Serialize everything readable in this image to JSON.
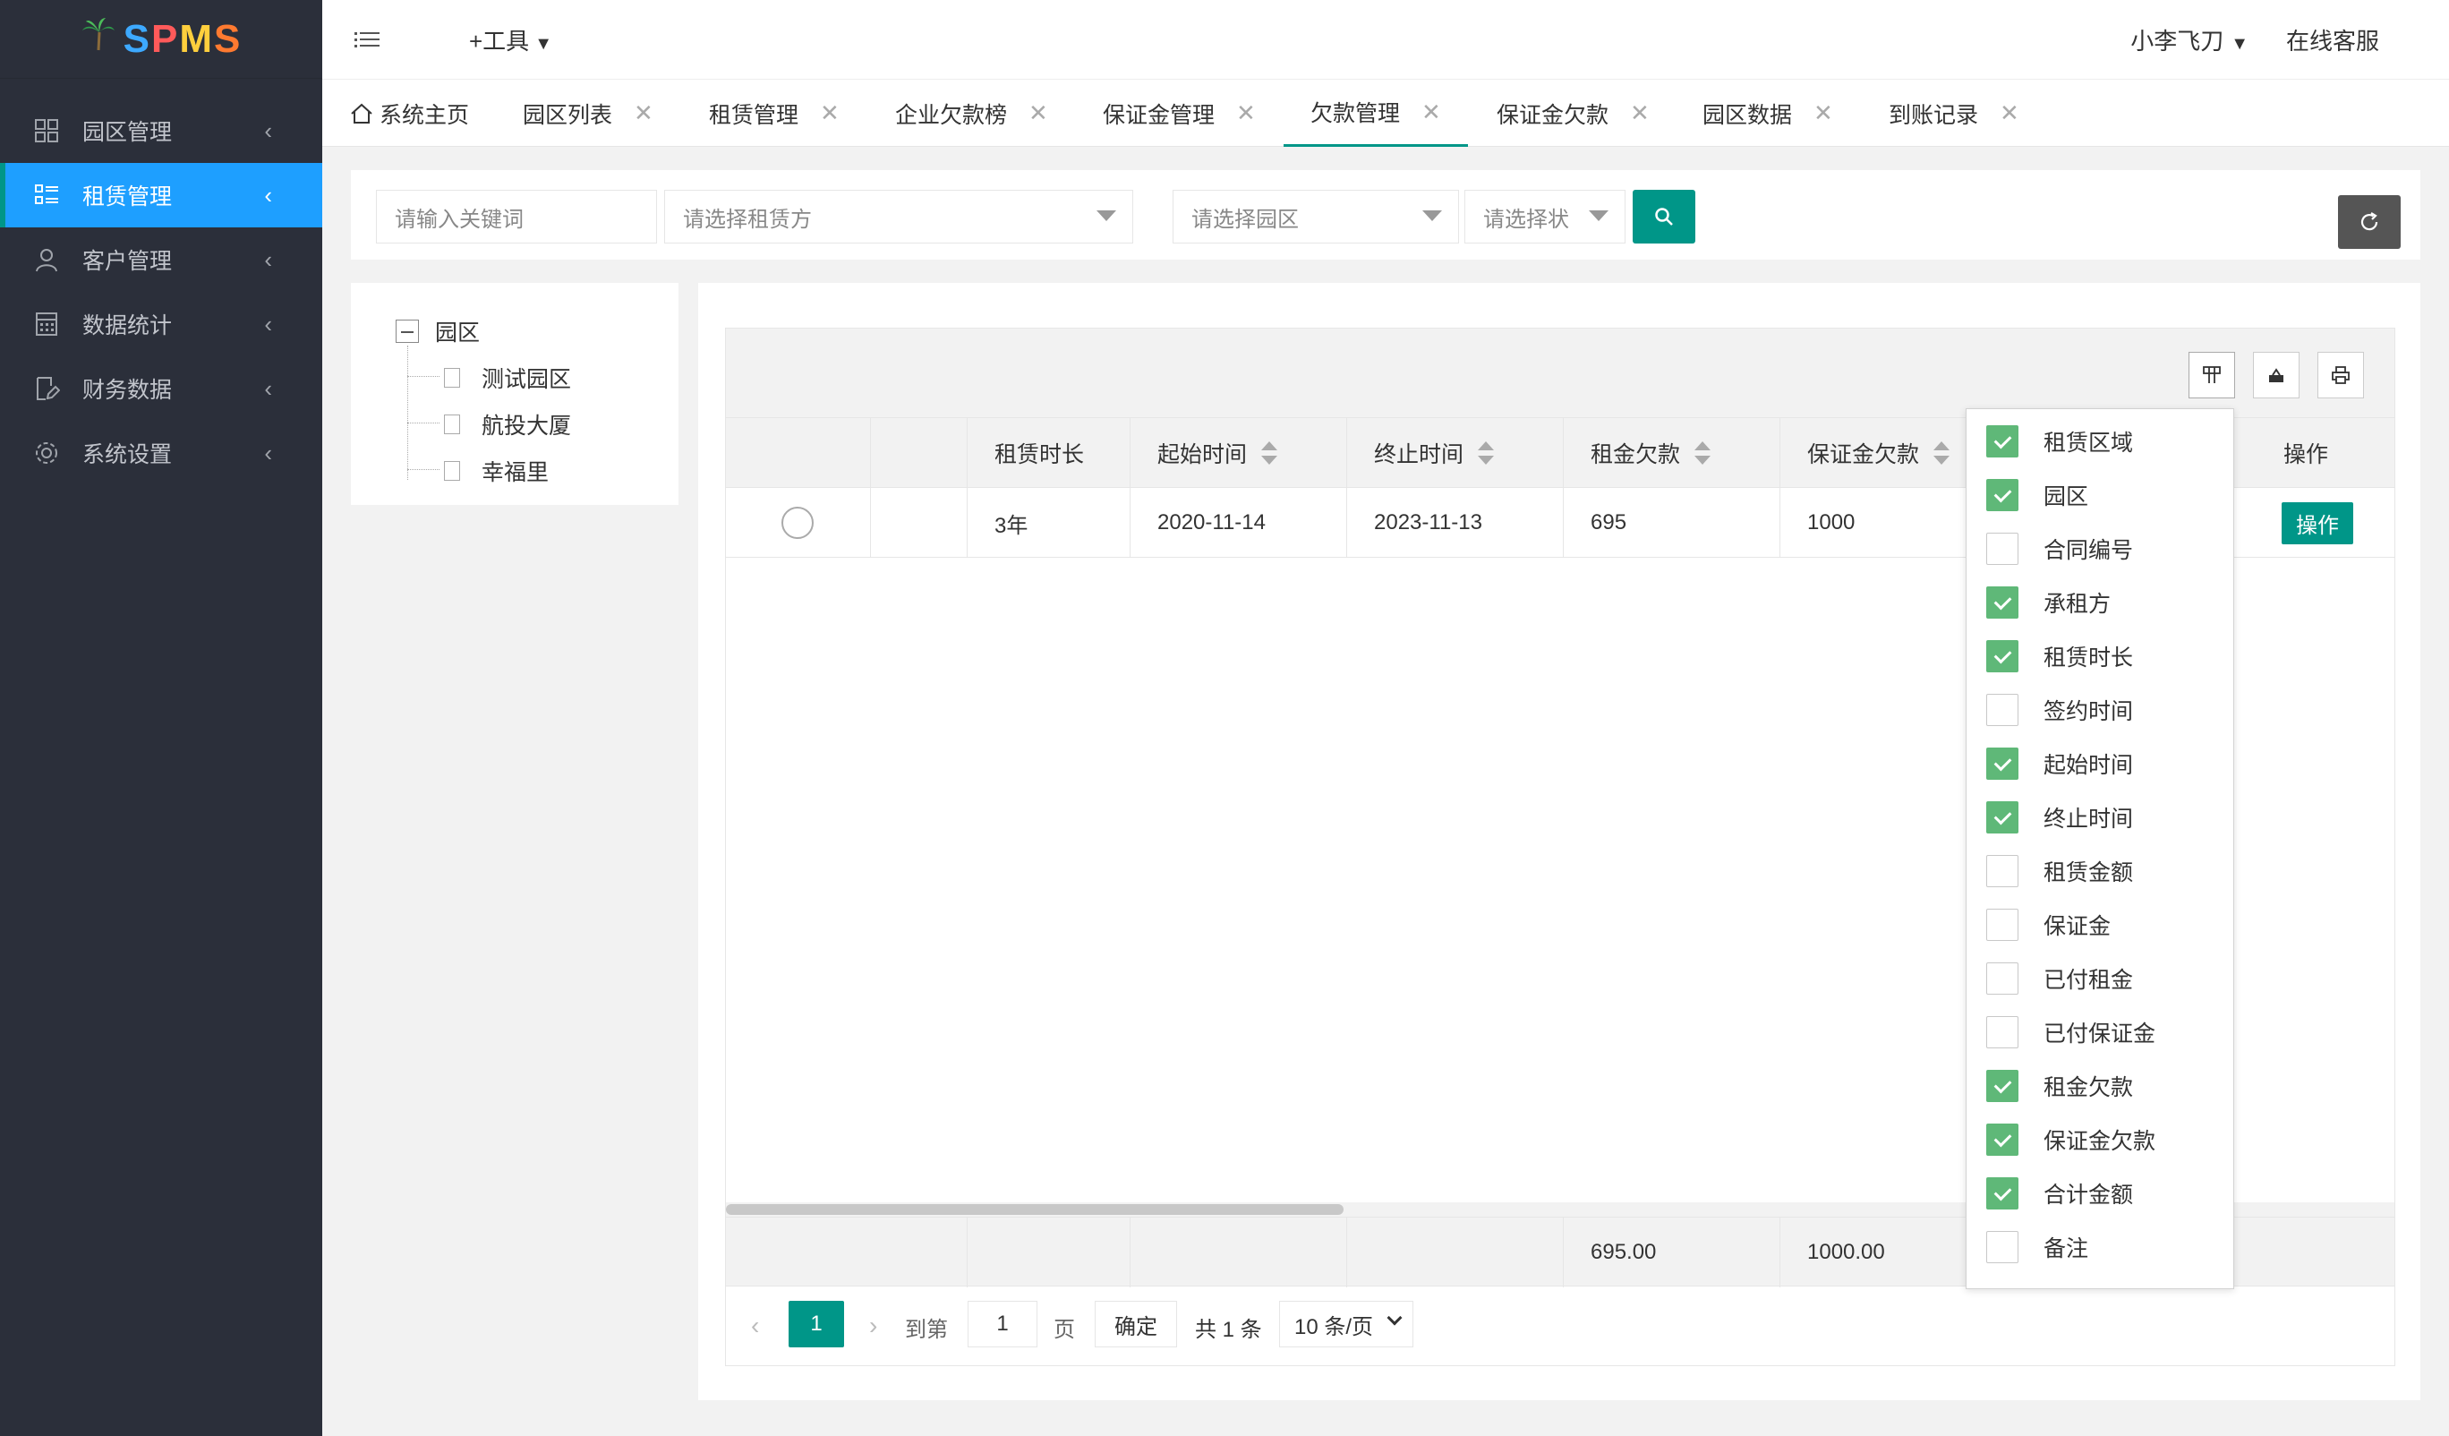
{
  "logo": {
    "text": "SPMS"
  },
  "sidebar": {
    "items": [
      {
        "label": "园区管理",
        "icon": "grid-icon"
      },
      {
        "label": "租赁管理",
        "icon": "list-icon",
        "active": true
      },
      {
        "label": "客户管理",
        "icon": "user-icon"
      },
      {
        "label": "数据统计",
        "icon": "calculator-icon"
      },
      {
        "label": "财务数据",
        "icon": "document-edit-icon"
      },
      {
        "label": "系统设置",
        "icon": "gear-icon"
      }
    ]
  },
  "header": {
    "tool_label": "+工具",
    "user_name": "小李飞刀",
    "service_label": "在线客服"
  },
  "tabs": [
    {
      "label": "系统主页"
    },
    {
      "label": "园区列表"
    },
    {
      "label": "租赁管理"
    },
    {
      "label": "企业欠款榜"
    },
    {
      "label": "保证金管理"
    },
    {
      "label": "欠款管理",
      "active": true
    },
    {
      "label": "保证金欠款"
    },
    {
      "label": "园区数据"
    },
    {
      "label": "到账记录"
    }
  ],
  "search": {
    "keyword_placeholder": "请输入关键词",
    "lessee_placeholder": "请选择租赁方",
    "park_placeholder": "请选择园区",
    "status_placeholder": "请选择状"
  },
  "tree": {
    "root": "园区",
    "children": [
      "测试园区",
      "航投大厦",
      "幸福里"
    ]
  },
  "table": {
    "headers": [
      "租赁时长",
      "起始时间",
      "终止时间",
      "租金欠款",
      "保证金欠款",
      "操作"
    ],
    "rows": [
      {
        "duration": "3年",
        "start": "2020-11-14",
        "end": "2023-11-13",
        "rent_due": "695",
        "deposit_due": "1000",
        "action": "操作"
      }
    ],
    "totals": {
      "rent_due": "695.00",
      "deposit_due": "1000.00"
    }
  },
  "pager": {
    "current": "1",
    "goto_label": "到第",
    "goto_value": "1",
    "page_label": "页",
    "confirm_label": "确定",
    "total_label": "共 1 条",
    "page_size_label": "10 条/页"
  },
  "column_picker": [
    {
      "label": "租赁区域",
      "checked": true
    },
    {
      "label": "园区",
      "checked": true
    },
    {
      "label": "合同编号",
      "checked": false
    },
    {
      "label": "承租方",
      "checked": true
    },
    {
      "label": "租赁时长",
      "checked": true
    },
    {
      "label": "签约时间",
      "checked": false
    },
    {
      "label": "起始时间",
      "checked": true
    },
    {
      "label": "终止时间",
      "checked": true
    },
    {
      "label": "租赁金额",
      "checked": false
    },
    {
      "label": "保证金",
      "checked": false
    },
    {
      "label": "已付租金",
      "checked": false
    },
    {
      "label": "已付保证金",
      "checked": false
    },
    {
      "label": "租金欠款",
      "checked": true
    },
    {
      "label": "保证金欠款",
      "checked": true
    },
    {
      "label": "合计金额",
      "checked": true
    },
    {
      "label": "备注",
      "checked": false
    }
  ],
  "colors": {
    "primary": "#009688",
    "active_menu": "#1e9fff",
    "sidebar_bg": "#2b2f3a",
    "checkbox_checked": "#5fb878"
  }
}
